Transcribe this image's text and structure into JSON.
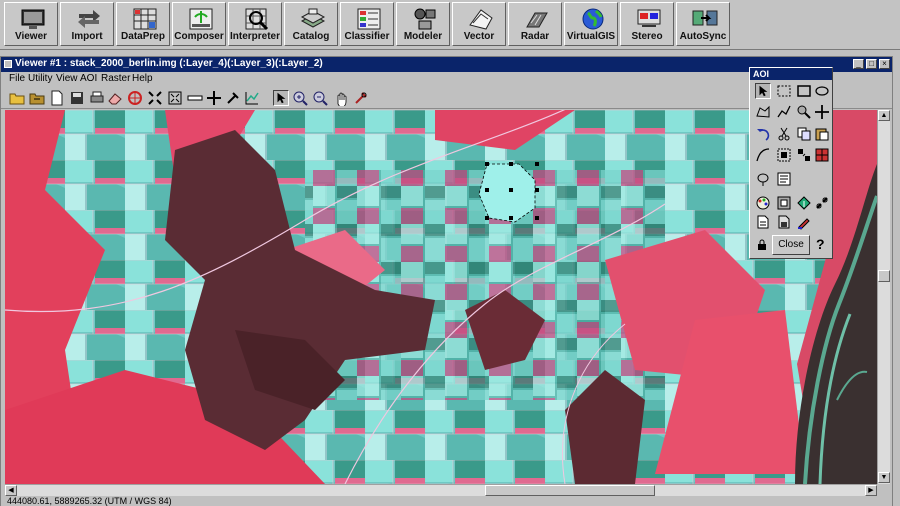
{
  "toolbar": {
    "items": [
      {
        "label": "Viewer",
        "icon": "monitor-icon"
      },
      {
        "label": "Import",
        "icon": "import-export-arrows-icon"
      },
      {
        "label": "DataPrep",
        "icon": "data-grid-icon"
      },
      {
        "label": "Composer",
        "icon": "map-composer-icon"
      },
      {
        "label": "Interpreter",
        "icon": "magnifier-grid-icon"
      },
      {
        "label": "Catalog",
        "icon": "catalog-cabinet-icon"
      },
      {
        "label": "Classifier",
        "icon": "classifier-icon"
      },
      {
        "label": "Modeler",
        "icon": "modeler-shapes-icon"
      },
      {
        "label": "Vector",
        "icon": "vector-icon"
      },
      {
        "label": "Radar",
        "icon": "radar-icon"
      },
      {
        "label": "VirtualGIS",
        "icon": "globe-icon"
      },
      {
        "label": "Stereo",
        "icon": "stereo-glasses-icon"
      },
      {
        "label": "AutoSync",
        "icon": "autosync-icon"
      }
    ]
  },
  "viewer": {
    "title": "Viewer #1 : stack_2000_berlin.img (:Layer_4)(:Layer_3)(:Layer_2)",
    "menu": [
      "File",
      "Utility",
      "View",
      "AOI",
      "Raster",
      "Help"
    ],
    "status": "444080.61, 5889265.32  (UTM / WGS 84)"
  },
  "aoi": {
    "title": "AOI",
    "close_label": "Close",
    "help_label": "?"
  },
  "colors": {
    "titlebar": "#0a246a",
    "vegetation": "#e0405a",
    "water_forest": "#5a2a30",
    "fields_cyan": "#78dcd6"
  }
}
